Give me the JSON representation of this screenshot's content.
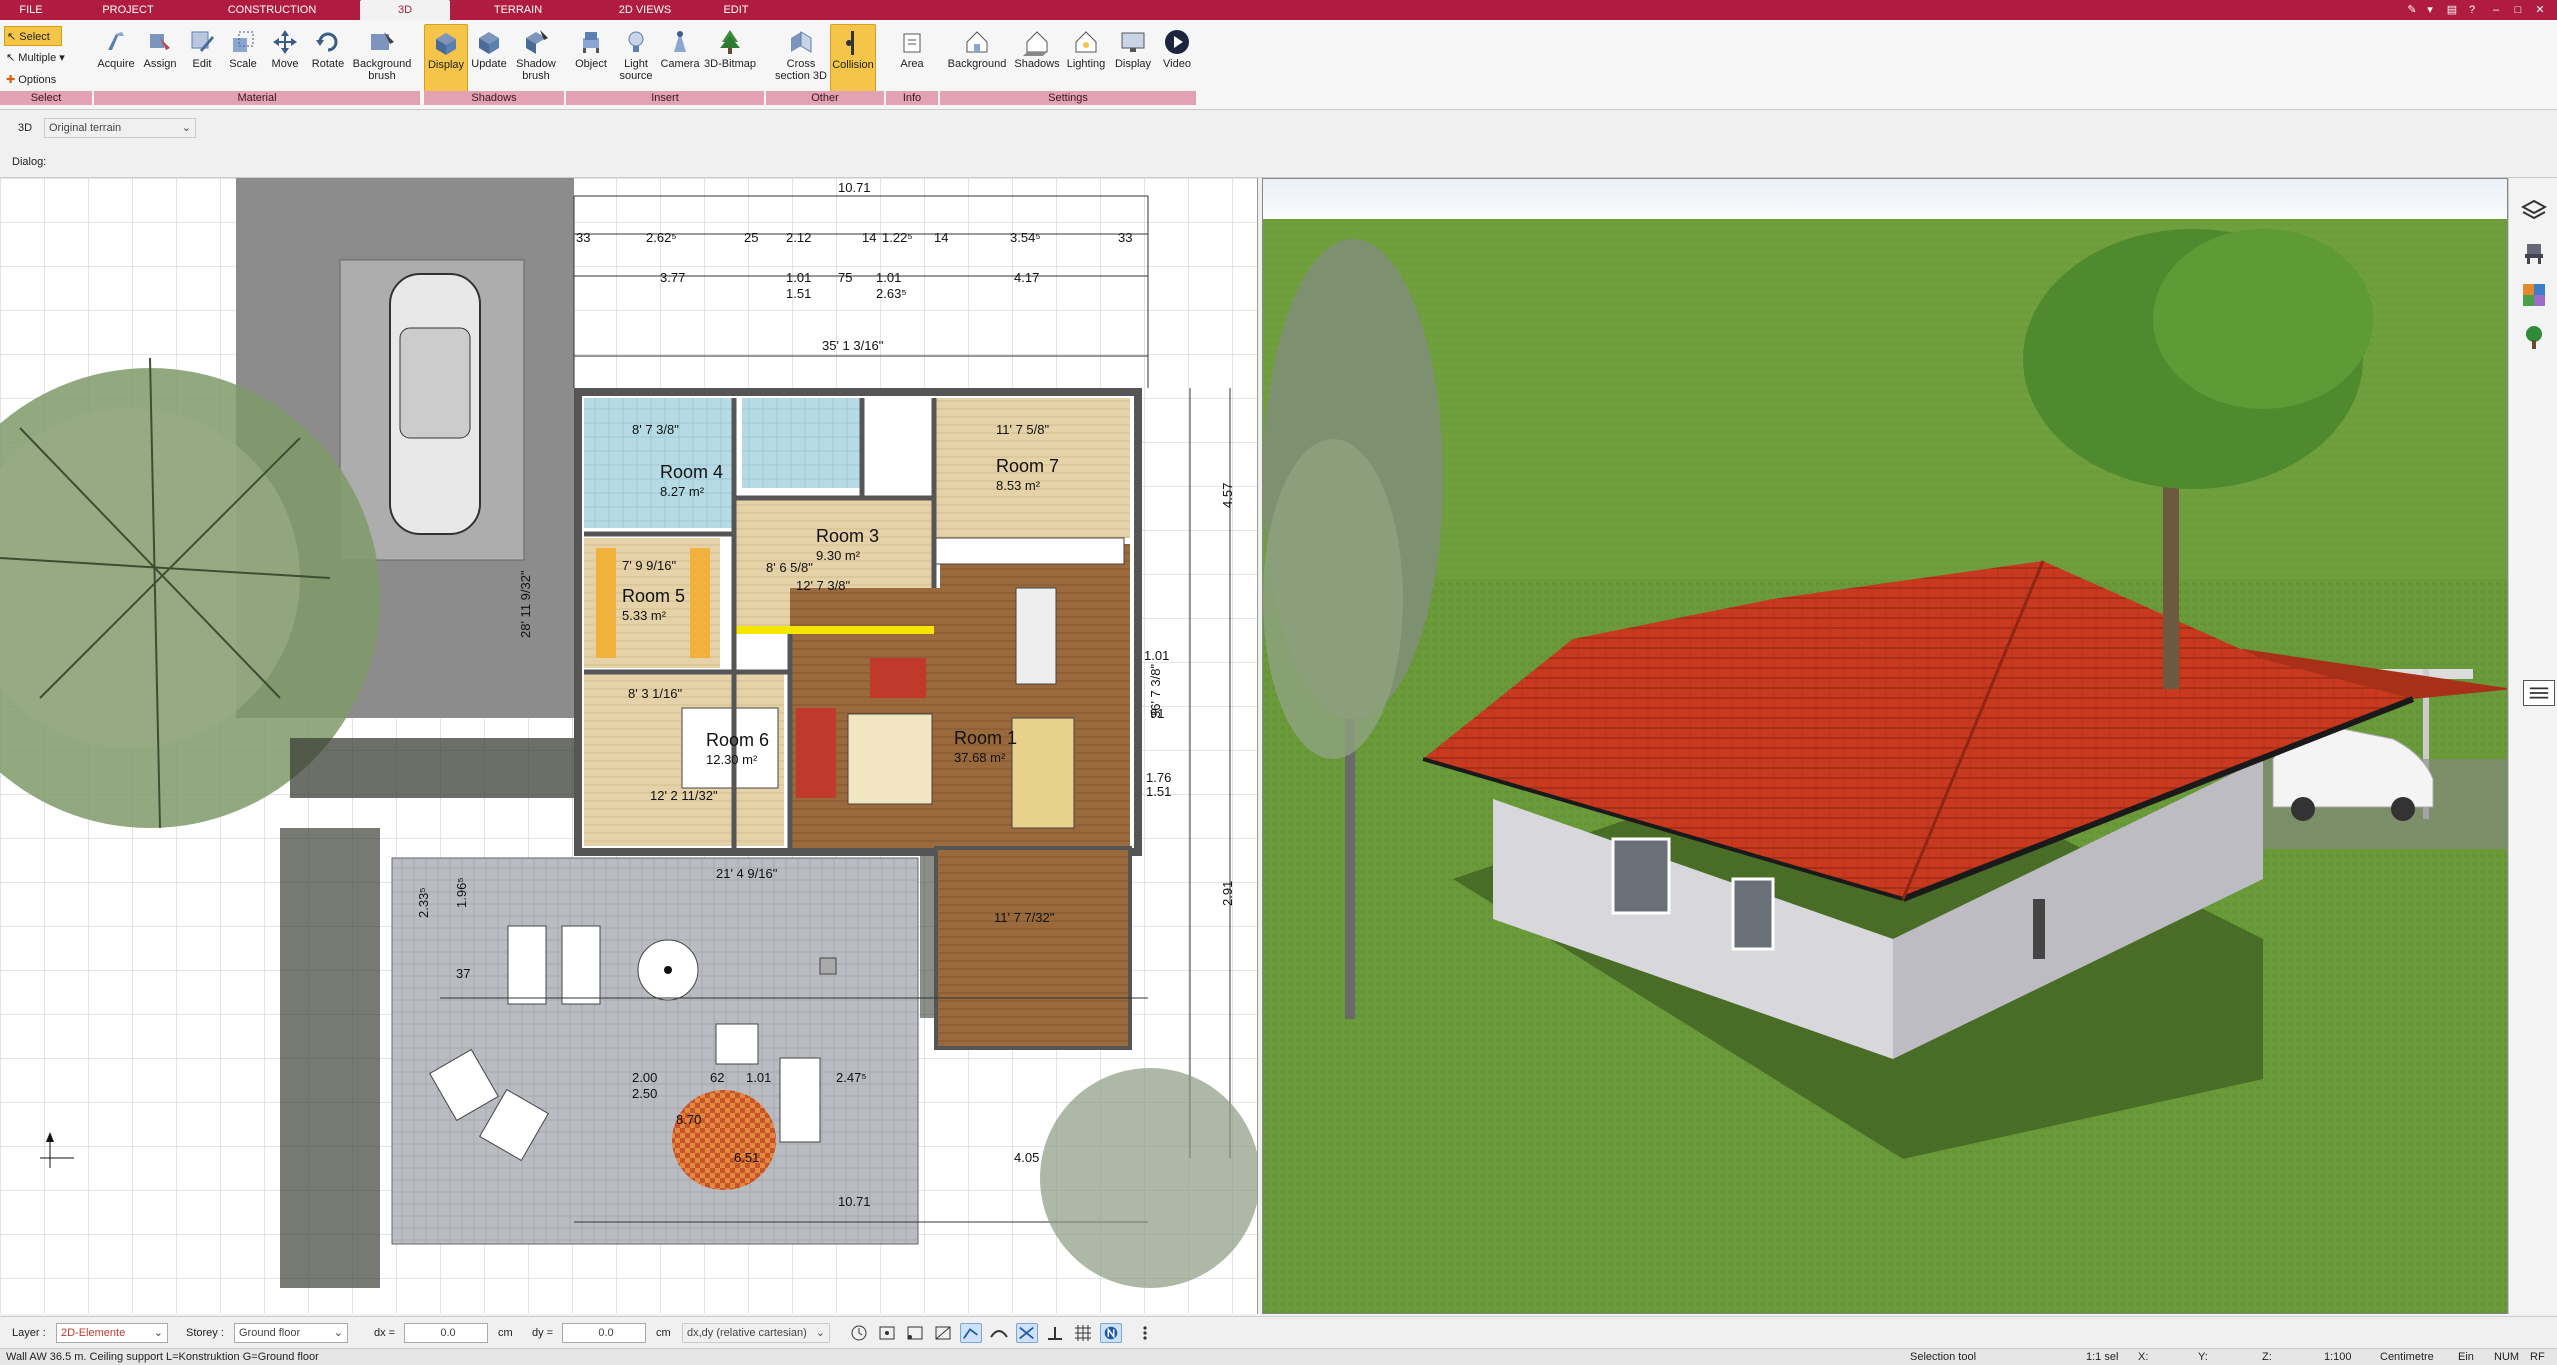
{
  "tabs": [
    "FILE",
    "PROJECT",
    "CONSTRUCTION",
    "3D",
    "TERRAIN",
    "2D VIEWS",
    "EDIT"
  ],
  "active_tab": "3D",
  "ribbon": {
    "select": {
      "select_label": "Select",
      "multiple_label": "Multiple",
      "options_label": "Options",
      "group": "Select"
    },
    "material": {
      "buttons": [
        "Acquire",
        "Assign",
        "Edit",
        "Scale",
        "Move",
        "Rotate",
        "Background brush"
      ],
      "group": "Material"
    },
    "shadows": {
      "buttons": [
        "Display",
        "Update",
        "Shadow brush"
      ],
      "group": "Shadows"
    },
    "insert": {
      "buttons": [
        "Object",
        "Light source",
        "Camera",
        "3D-Bitmap"
      ],
      "group": "Insert"
    },
    "other": {
      "buttons": [
        "Cross section 3D",
        "Collision"
      ],
      "group": "Other"
    },
    "info": {
      "buttons": [
        "Area"
      ],
      "group": "Info"
    },
    "settings": {
      "buttons": [
        "Background",
        "Shadows",
        "Lighting",
        "Display",
        "Video"
      ],
      "group": "Settings"
    }
  },
  "viewbar": {
    "mode": "3D",
    "terrain": "Original terrain"
  },
  "dialog_label": "Dialog:",
  "plan": {
    "rooms": [
      {
        "name": "Room 4",
        "area": "8.27 m²"
      },
      {
        "name": "Room 7",
        "area": "8.53 m²"
      },
      {
        "name": "Room 3",
        "area": "9.30 m²"
      },
      {
        "name": "Room 5",
        "area": "5.33 m²"
      },
      {
        "name": "Room 6",
        "area": "12.30 m²"
      },
      {
        "name": "Room 1",
        "area": "37.68 m²"
      }
    ],
    "dims_top": [
      "10.71",
      "33",
      "2.62⁵",
      "25",
      "2.12",
      "14",
      "1.22⁵",
      "14",
      "3.54⁵",
      "33",
      "3.77",
      "1.01",
      "75",
      "1.01",
      "4.17",
      "1.51",
      "2.63⁵"
    ],
    "dims_misc": [
      "35' 1 3/16\"",
      "11' 7 5/8\"",
      "8' 7 3/8\"",
      "8' 6 5/8\"",
      "12' 7 3/8\"",
      "7' 9 9/16\"",
      "8' 3 1/16\"",
      "12' 2 11/32\"",
      "21' 4 9/16\"",
      "11' 7 7/32\"",
      "28' 11 9/32\"",
      "36' 7 3/8\"",
      "4.57",
      "1.01",
      "91",
      "1.76",
      "1.51",
      "2.91",
      "1.96⁵",
      "2.33⁵",
      "37",
      "2.00",
      "2.50",
      "62",
      "1.01",
      "2.47⁵",
      "6.51",
      "10.71",
      "8.70",
      "4.05"
    ]
  },
  "bottombar": {
    "layer_label": "Layer :",
    "layer_value": "2D-Elemente",
    "storey_label": "Storey :",
    "storey_value": "Ground floor",
    "dx_label": "dx =",
    "dx_value": "0.0",
    "dx_unit": "cm",
    "dy_label": "dy =",
    "dy_value": "0.0",
    "dy_unit": "cm",
    "coord_mode": "dx,dy (relative cartesian)"
  },
  "statusbar": {
    "message": "Wall AW 36.5 m. Ceiling support L=Konstruktion G=Ground floor",
    "tool": "Selection tool",
    "sel": "1:1 sel",
    "x": "X:",
    "y": "Y:",
    "z": "Z:",
    "scale": "1:100",
    "unit": "Centimetre",
    "ein": "Ein",
    "num": "NUM",
    "rf": "RF"
  },
  "colors": {
    "accent": "#b01c3f",
    "ribbon_group": "#e3a2b3",
    "selected": "#f5c54a",
    "roof": "#c8391f",
    "grass": "#5a8a2e"
  },
  "icons": [
    "acquire-icon",
    "assign-icon",
    "edit-icon",
    "scale-icon",
    "move-icon",
    "rotate-icon",
    "background-brush-icon",
    "display-icon",
    "update-icon",
    "shadow-brush-icon",
    "object-icon",
    "light-source-icon",
    "camera-icon",
    "bitmap-icon",
    "cross-section-icon",
    "collision-icon",
    "area-icon",
    "background-icon",
    "shadows-icon",
    "lighting-icon",
    "settings-display-icon",
    "video-icon"
  ]
}
